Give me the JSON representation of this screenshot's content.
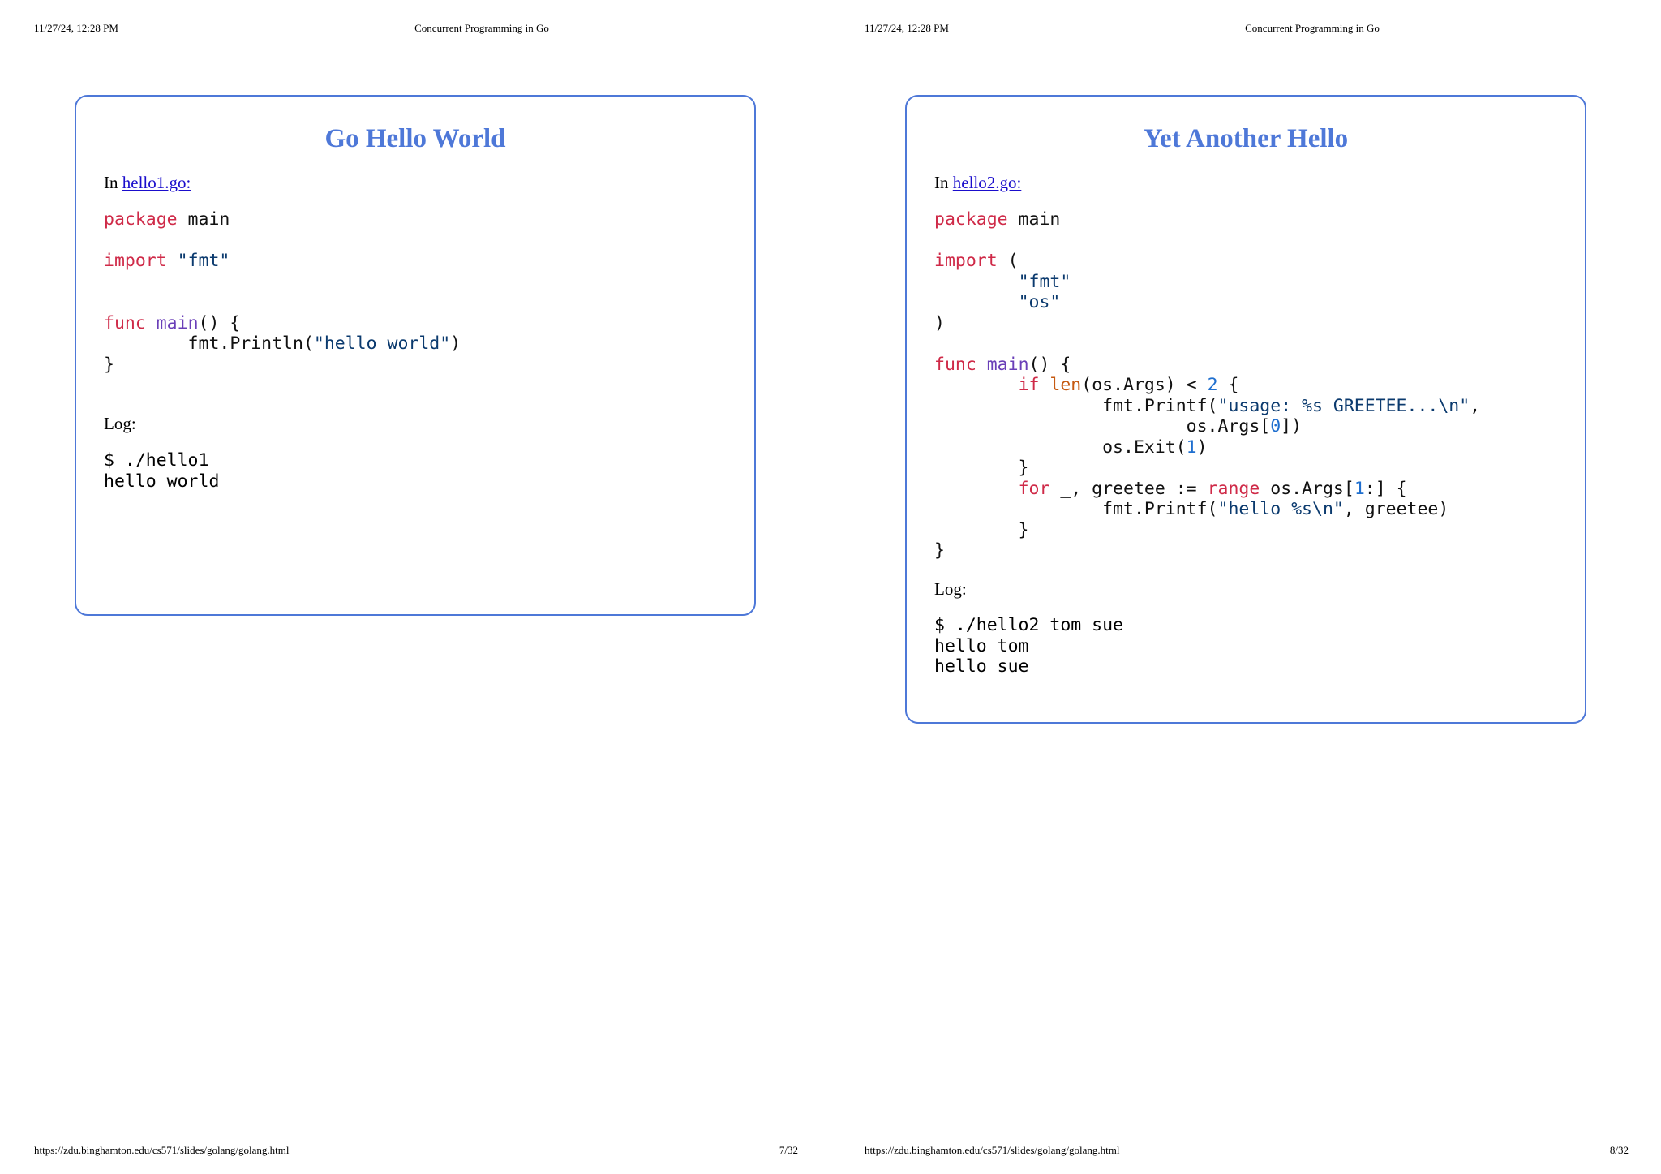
{
  "pages": [
    {
      "header": {
        "date": "11/27/24, 12:28 PM",
        "doc_title": "Concurrent Programming in Go"
      },
      "footer": {
        "url": "https://zdu.binghamton.edu/cs571/slides/golang/golang.html",
        "page": "7/32"
      },
      "slide": {
        "title": "Go Hello World",
        "intro_prefix": "In ",
        "file_link": "hello1.go:",
        "log_label": "Log:",
        "code_lines": [
          [
            {
              "t": "package",
              "c": "kw"
            },
            {
              "t": " main"
            }
          ],
          [],
          [
            {
              "t": "import",
              "c": "kw"
            },
            {
              "t": " "
            },
            {
              "t": "\"fmt\"",
              "c": "str"
            }
          ],
          [],
          [],
          [
            {
              "t": "func",
              "c": "kw"
            },
            {
              "t": " "
            },
            {
              "t": "main",
              "c": "fn"
            },
            {
              "t": "() {"
            }
          ],
          [
            {
              "t": "        fmt.Println("
            },
            {
              "t": "\"hello world\"",
              "c": "str"
            },
            {
              "t": ")"
            }
          ],
          [
            {
              "t": "}"
            }
          ]
        ],
        "log_lines": [
          "$ ./hello1",
          "hello world"
        ]
      }
    },
    {
      "header": {
        "date": "11/27/24, 12:28 PM",
        "doc_title": "Concurrent Programming in Go"
      },
      "footer": {
        "url": "https://zdu.binghamton.edu/cs571/slides/golang/golang.html",
        "page": "8/32"
      },
      "slide": {
        "title": "Yet Another Hello",
        "intro_prefix": "In ",
        "file_link": "hello2.go:",
        "log_label": "Log:",
        "code_lines": [
          [
            {
              "t": "package",
              "c": "kw"
            },
            {
              "t": " main"
            }
          ],
          [],
          [
            {
              "t": "import",
              "c": "kw"
            },
            {
              "t": " ("
            }
          ],
          [
            {
              "t": "        "
            },
            {
              "t": "\"fmt\"",
              "c": "str"
            }
          ],
          [
            {
              "t": "        "
            },
            {
              "t": "\"os\"",
              "c": "str"
            }
          ],
          [
            {
              "t": ")"
            }
          ],
          [],
          [
            {
              "t": "func",
              "c": "kw"
            },
            {
              "t": " "
            },
            {
              "t": "main",
              "c": "fn"
            },
            {
              "t": "() {"
            }
          ],
          [
            {
              "t": "        "
            },
            {
              "t": "if",
              "c": "kw"
            },
            {
              "t": " "
            },
            {
              "t": "len",
              "c": "bi"
            },
            {
              "t": "(os.Args) < "
            },
            {
              "t": "2",
              "c": "num"
            },
            {
              "t": " {"
            }
          ],
          [
            {
              "t": "                fmt.Printf("
            },
            {
              "t": "\"usage: %s GREETEE...\\n\"",
              "c": "str"
            },
            {
              "t": ","
            }
          ],
          [
            {
              "t": "                        os.Args["
            },
            {
              "t": "0",
              "c": "num"
            },
            {
              "t": "])"
            }
          ],
          [
            {
              "t": "                os.Exit("
            },
            {
              "t": "1",
              "c": "num"
            },
            {
              "t": ")"
            }
          ],
          [
            {
              "t": "        }"
            }
          ],
          [
            {
              "t": "        "
            },
            {
              "t": "for",
              "c": "kw"
            },
            {
              "t": " _, greetee := "
            },
            {
              "t": "range",
              "c": "kw"
            },
            {
              "t": " os.Args["
            },
            {
              "t": "1",
              "c": "num"
            },
            {
              "t": ":] {"
            }
          ],
          [
            {
              "t": "                fmt.Printf("
            },
            {
              "t": "\"hello %s\\n\"",
              "c": "str"
            },
            {
              "t": ", greetee)"
            }
          ],
          [
            {
              "t": "        }"
            }
          ],
          [
            {
              "t": "}"
            }
          ]
        ],
        "log_lines": [
          "$ ./hello2 tom sue",
          "hello tom",
          "hello sue"
        ]
      }
    }
  ],
  "colors": {
    "accent": "#4e78d8",
    "keyword": "#cf2a48",
    "function": "#6a3fb8",
    "string": "#0b3a6e",
    "number": "#1f6fcf",
    "builtin": "#c65a11",
    "link": "#1a0dcc"
  }
}
